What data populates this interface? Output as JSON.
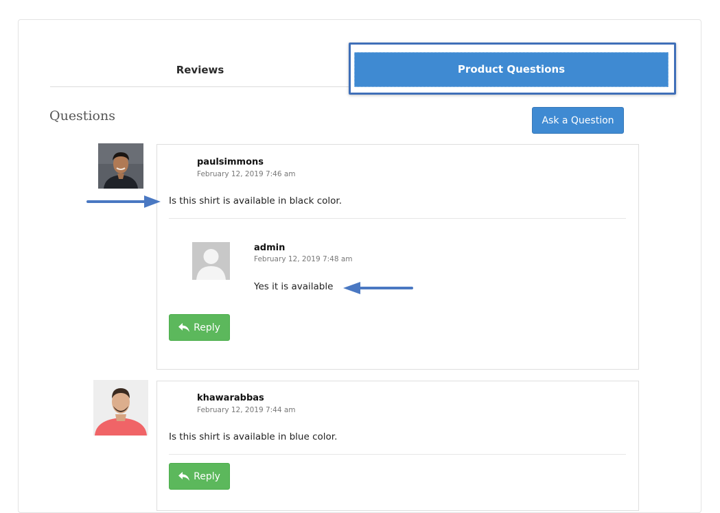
{
  "tabs": {
    "reviews_label": "Reviews",
    "product_questions_label": "Product Questions"
  },
  "questions_section": {
    "heading": "Questions",
    "ask_button_label": "Ask a Question"
  },
  "questions": [
    {
      "author": "paulsimmons",
      "timestamp": "February 12, 2019 7:46 am",
      "text": "Is this shirt is available in black color.",
      "answers": [
        {
          "author": "admin",
          "timestamp": "February 12, 2019 7:48 am",
          "text": "Yes it is available"
        }
      ],
      "reply_label": "Reply"
    },
    {
      "author": "khawarabbas",
      "timestamp": "February 12, 2019 7:44 am",
      "text": "Is this shirt is available in blue color.",
      "reply_label": "Reply"
    }
  ],
  "colors": {
    "accent_blue": "#3f8ad2",
    "highlight_border": "#3f6fb8",
    "reply_green": "#5cb85c",
    "annotation_arrow": "#4a78c2"
  },
  "icons": {
    "reply": "reply-icon",
    "avatar_placeholder": "default-avatar-icon",
    "annotation": "arrow-annotation-icon"
  }
}
